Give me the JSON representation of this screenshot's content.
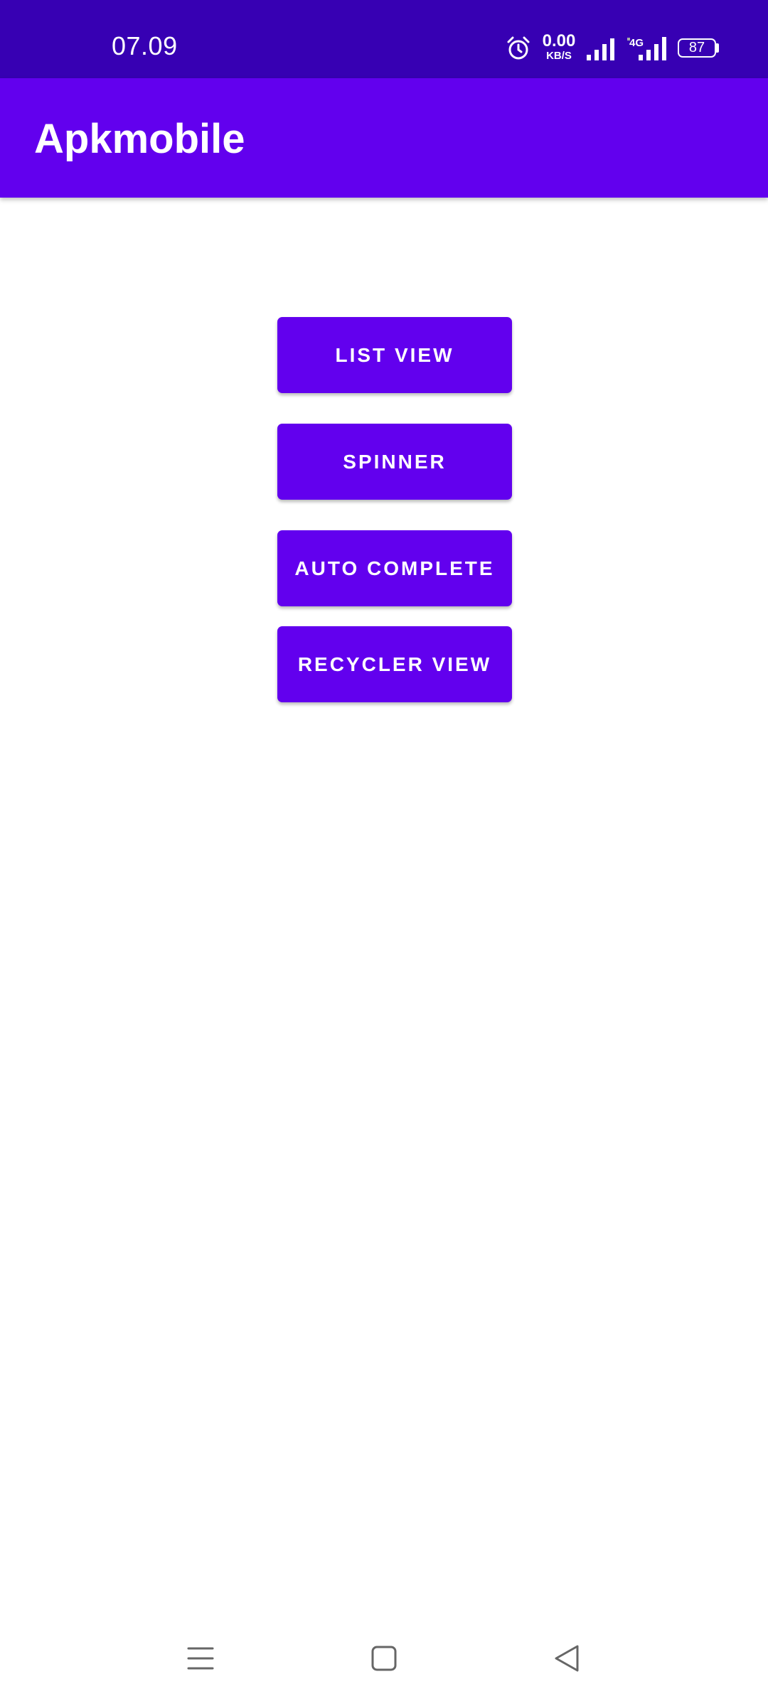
{
  "status_bar": {
    "time": "07.09",
    "net_speed_value": "0.00",
    "net_speed_unit": "KB/S",
    "network_type": "4G",
    "battery_level": "87",
    "icons": [
      "alarm-icon",
      "signal-icon",
      "signal-4g-icon",
      "battery-icon"
    ]
  },
  "app_bar": {
    "title": "Apkmobile"
  },
  "main": {
    "buttons": [
      {
        "label": "LIST VIEW"
      },
      {
        "label": "SPINNER"
      },
      {
        "label": "AUTO COMPLETE"
      },
      {
        "label": "RECYCLER VIEW"
      }
    ]
  },
  "nav_bar": {
    "icons": [
      "menu-icon",
      "home-icon",
      "back-icon"
    ]
  },
  "colors": {
    "status_bar": "#3700b3",
    "primary": "#6200ee",
    "background": "#ffffff",
    "on_primary": "#ffffff"
  }
}
